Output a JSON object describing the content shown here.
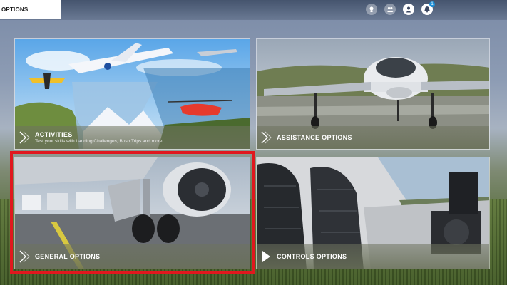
{
  "header": {
    "breadcrumb": "OPTIONS",
    "icons": [
      "achievements-icon",
      "friends-icon",
      "profile-icon",
      "notifications-icon"
    ],
    "notification_count": "1"
  },
  "tiles": [
    {
      "title": "ACTIVITIES",
      "subtitle": "Test your skills with Landing Challenges, Bush Trips and more"
    },
    {
      "title": "ASSISTANCE OPTIONS",
      "subtitle": ""
    },
    {
      "title": "GENERAL OPTIONS",
      "subtitle": ""
    },
    {
      "title": "CONTROLS OPTIONS",
      "subtitle": ""
    }
  ],
  "colors": {
    "focus_highlight": "#e0181e",
    "label_bar": "#6b7058",
    "notification_badge": "#1e8fd6"
  },
  "selected_tile": "GENERAL OPTIONS"
}
